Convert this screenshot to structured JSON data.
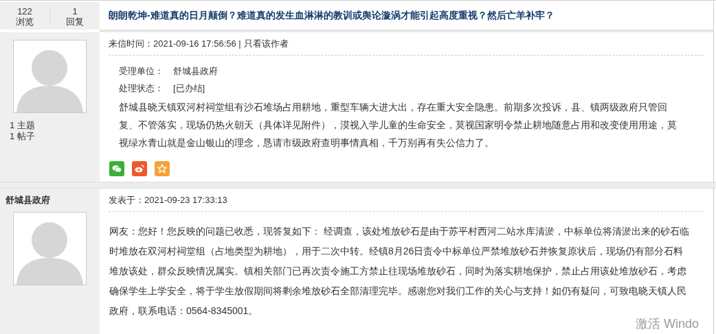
{
  "thread": {
    "views": "122",
    "views_label": "浏览",
    "replies": "1",
    "replies_label": "回复",
    "title": "朗朗乾坤-难道真的日月颠倒？难道真的发生血淋淋的教训或舆论漩涡才能引起高度重视？然后亡羊补牢？"
  },
  "posts": [
    {
      "author_stats": [
        "1 主题",
        "1 帖子"
      ],
      "meta": "来信时间：2021-09-16 17:56:56 |",
      "author_link": "只看该作者",
      "fields": [
        {
          "label": "受理单位：",
          "value": "舒城县政府"
        },
        {
          "label": "处理状态：",
          "value": "[已办结]"
        }
      ],
      "body": "舒城县晓天镇双河村祠堂组有沙石堆场占用耕地，重型车辆大进大出，存在重大安全隐患。前期多次投诉，县、镇两级政府只管回复、不管落实，现场仍热火朝天（具体详见附件），漠视入学儿童的生命安全，莫视国家明令禁止耕地随意占用和改变使用用途，莫视绿水青山就是金山银山的理念，恳请市级政府查明事情真相，千万别再有失公信力了。",
      "share": [
        {
          "kind": "wechat"
        },
        {
          "kind": "weibo"
        },
        {
          "kind": "favorite"
        }
      ]
    },
    {
      "author": "舒城县政府",
      "meta": "发表于：2021-09-23 17:33:13",
      "body": "网友：您好！您反映的问题已收悉，现答复如下： 经调查，该处堆放砂石是由于苏平村西河二站水库清淤，中标单位将清淤出来的砂石临时堆放在双河村祠堂组（占地类型为耕地），用于二次中转。经镇8月26日责令中标单位严禁堆放砂石并恢复原状后，现场仍有部分石料堆放该处，群众反映情况属实。镇相关部门已再次责令施工方禁止往现场堆放砂石，同时为落实耕地保护，禁止占用该处堆放砂石，考虑确保学生上学安全，将于学生放假期间将剩余堆放砂石全部清理完毕。感谢您对我们工作的关心与支持！如仍有疑问，可致电晓天镇人民政府，联系电话：0564-8345001。"
    }
  ],
  "overlay": "激活 Windo"
}
